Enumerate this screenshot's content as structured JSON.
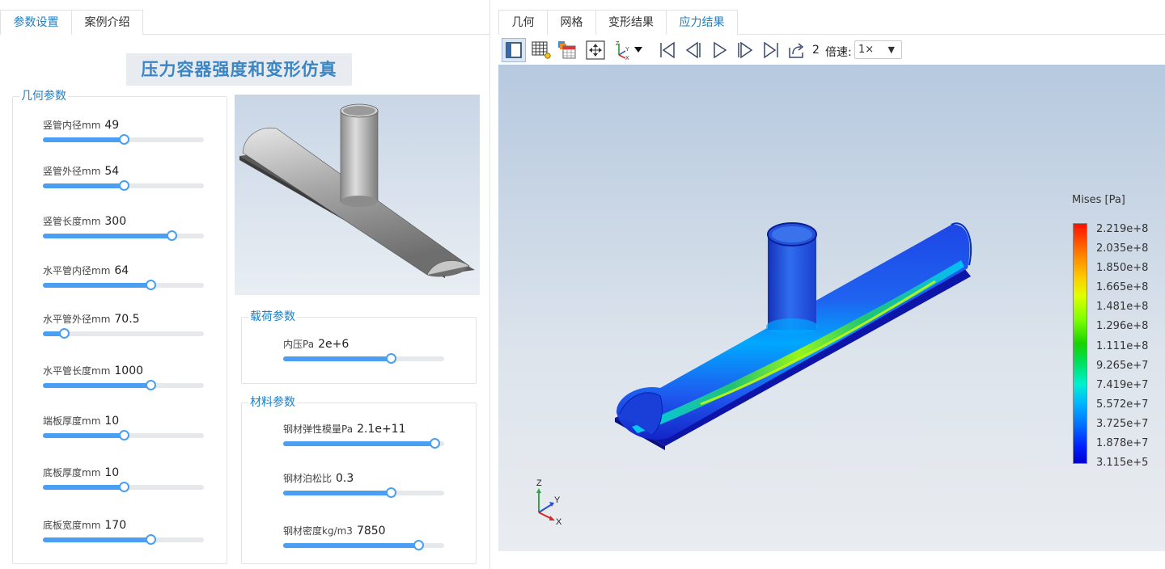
{
  "left_tabs": [
    {
      "label": "参数设置",
      "active": true
    },
    {
      "label": "案例介绍",
      "active": false
    }
  ],
  "page_title": "压力容器强度和变形仿真",
  "geometry_group": {
    "title": "几何参数",
    "params": [
      {
        "label": "竖管内径mm",
        "value": "49",
        "fraction": 0.5
      },
      {
        "label": "竖管外径mm",
        "value": "54",
        "fraction": 0.5
      },
      {
        "label": "竖管长度mm",
        "value": "300",
        "fraction": 0.8
      },
      {
        "label": "水平管内径mm",
        "value": "64",
        "fraction": 0.67
      },
      {
        "label": "水平管外径mm",
        "value": "70.5",
        "fraction": 0.13
      },
      {
        "label": "水平管长度mm",
        "value": "1000",
        "fraction": 0.67
      },
      {
        "label": "端板厚度mm",
        "value": "10",
        "fraction": 0.5
      },
      {
        "label": "底板厚度mm",
        "value": "10",
        "fraction": 0.5
      },
      {
        "label": "底板宽度mm",
        "value": "170",
        "fraction": 0.67
      }
    ]
  },
  "load_group": {
    "title": "载荷参数",
    "params": [
      {
        "label": "内压Pa",
        "value": "2e+6",
        "fraction": 0.67
      }
    ]
  },
  "material_group": {
    "title": "材料参数",
    "params": [
      {
        "label": "钢材弹性模量Pa",
        "value": "2.1e+11",
        "fraction": 0.94
      },
      {
        "label": "钢材泊松比",
        "value": "0.3",
        "fraction": 0.67
      },
      {
        "label": "钢材密度kg/m3",
        "value": "7850",
        "fraction": 0.84
      }
    ]
  },
  "right_tabs": [
    {
      "label": "几何",
      "active": false
    },
    {
      "label": "网格",
      "active": false
    },
    {
      "label": "变形结果",
      "active": false
    },
    {
      "label": "应力结果",
      "active": true
    }
  ],
  "toolbar": {
    "icons": [
      "model-view-icon",
      "mesh-view-icon",
      "table-view-icon",
      "fit-view-icon",
      "axes-orientation-icon",
      "first-frame-icon",
      "prev-frame-icon",
      "play-icon",
      "next-frame-icon",
      "last-frame-icon",
      "export-icon"
    ],
    "frame": "2",
    "speed_label": "倍速:",
    "speed_value": "1×"
  },
  "legend": {
    "title": "Mises [Pa]",
    "labels": [
      "2.219e+8",
      "2.035e+8",
      "1.850e+8",
      "1.665e+8",
      "1.481e+8",
      "1.296e+8",
      "1.111e+8",
      "9.265e+7",
      "7.419e+7",
      "5.572e+7",
      "3.725e+7",
      "1.878e+7",
      "3.115e+5"
    ]
  },
  "triad": {
    "x": "X",
    "y": "Y",
    "z": "Z"
  },
  "colors": {
    "accent": "#1e7fc5",
    "slider": "#4a9ff0"
  }
}
